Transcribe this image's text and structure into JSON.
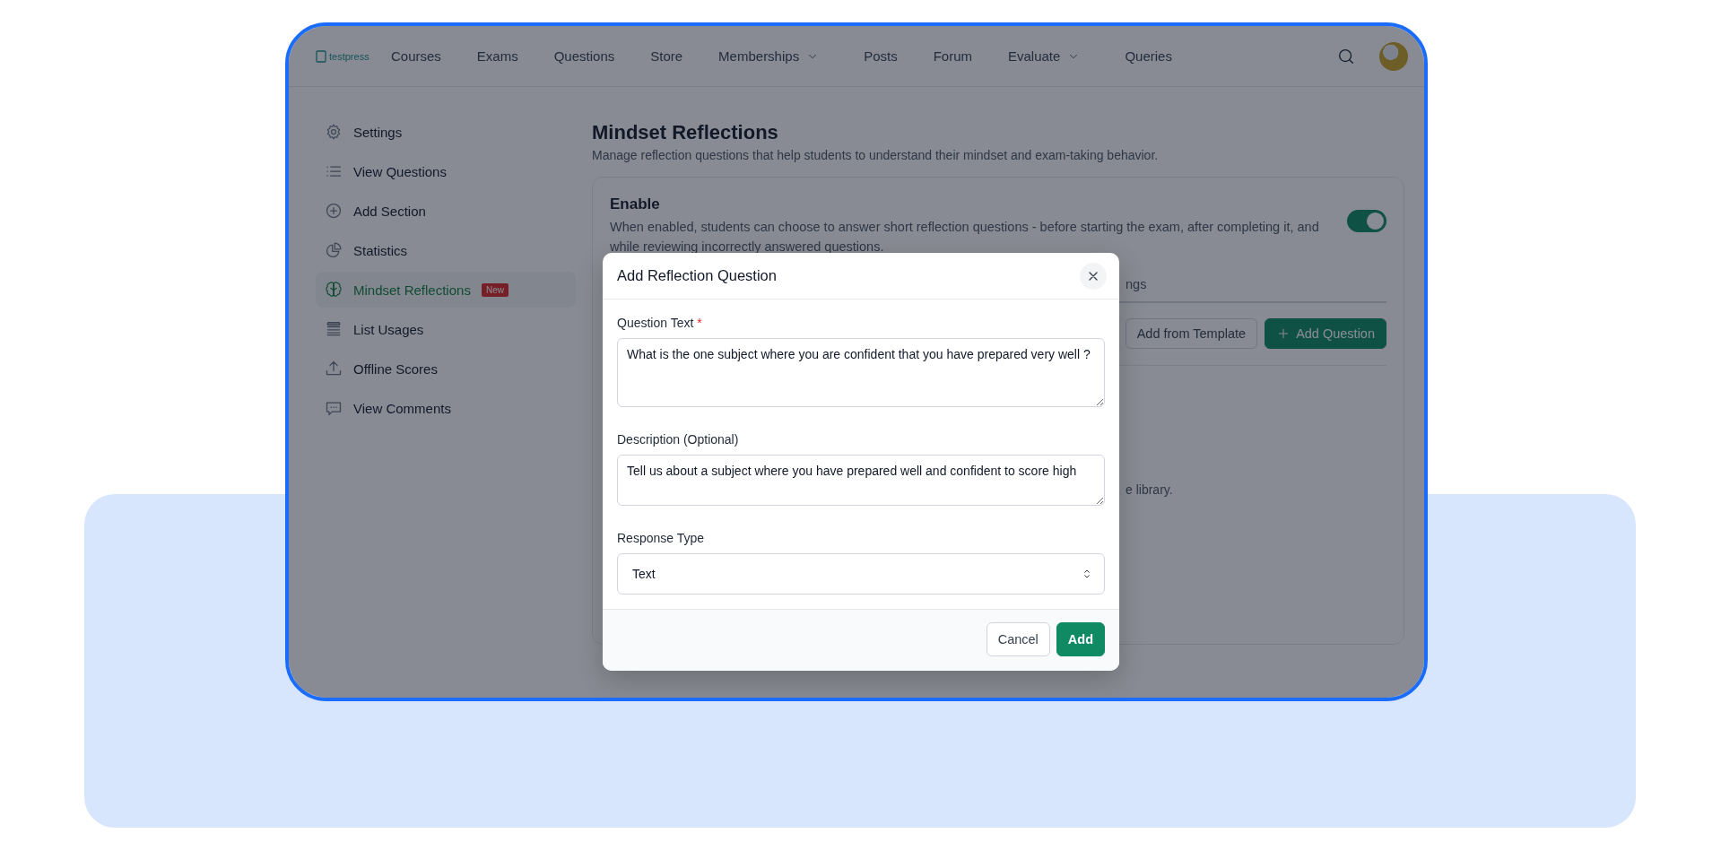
{
  "nav": {
    "logo": "testpress",
    "items": [
      {
        "label": "Courses",
        "dropdown": false
      },
      {
        "label": "Exams",
        "dropdown": false
      },
      {
        "label": "Questions",
        "dropdown": false
      },
      {
        "label": "Store",
        "dropdown": false
      },
      {
        "label": "Memberships",
        "dropdown": true
      },
      {
        "label": "Posts",
        "dropdown": false
      },
      {
        "label": "Forum",
        "dropdown": false
      },
      {
        "label": "Evaluate",
        "dropdown": true
      },
      {
        "label": "Queries",
        "dropdown": false
      }
    ]
  },
  "sidebar": {
    "items": [
      {
        "label": "Settings",
        "selected": false
      },
      {
        "label": "View Questions",
        "selected": false
      },
      {
        "label": "Add Section",
        "selected": false
      },
      {
        "label": "Statistics",
        "selected": false
      },
      {
        "label": "Mindset Reflections",
        "selected": true,
        "badge": "New"
      },
      {
        "label": "List Usages",
        "selected": false
      },
      {
        "label": "Offline Scores",
        "selected": false
      },
      {
        "label": "View Comments",
        "selected": false
      }
    ]
  },
  "page": {
    "title": "Mindset Reflections",
    "subtitle": "Manage reflection questions that help students to understand their mindset and exam-taking behavior.",
    "enable": {
      "title": "Enable",
      "description": "When enabled, students can choose to answer short reflection questions - before starting the exam, after completing it, and while reviewing incorrectly answered questions.",
      "on": true
    },
    "tab_fragment": "ngs",
    "buttons": [
      {
        "label": "Add from Template",
        "kind": "secondary"
      },
      {
        "label": "Add Question",
        "kind": "primary"
      }
    ],
    "library_fragment": "e library."
  },
  "modal": {
    "title": "Add Reflection Question",
    "fields": [
      {
        "kind": "textarea",
        "label": "Question Text",
        "required_mark": "*",
        "value": "What is the one subject where you are confident that you have prepared very well ?"
      },
      {
        "kind": "textarea",
        "label": "Description (Optional)",
        "value": "Tell us about a subject where you have prepared well and confident to score high"
      },
      {
        "kind": "select",
        "label": "Response Type",
        "value": "Text"
      }
    ],
    "buttons": [
      {
        "label": "Cancel",
        "kind": "secondary"
      },
      {
        "label": "Add",
        "kind": "primary"
      }
    ]
  }
}
